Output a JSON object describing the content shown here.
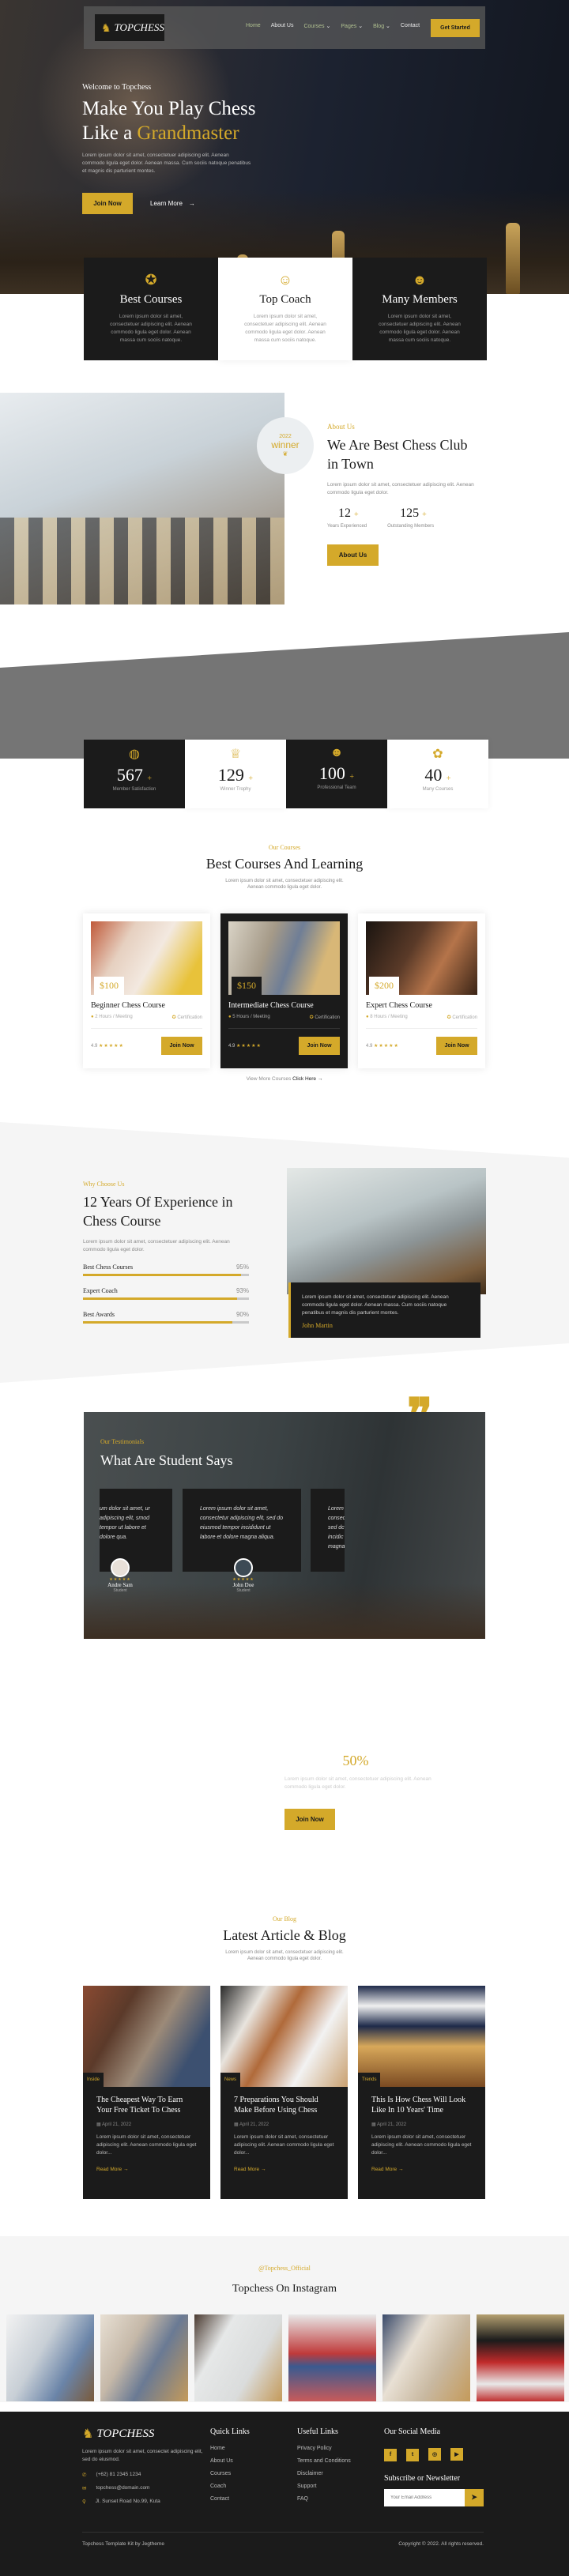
{
  "brand": {
    "name": "TOPCHESS",
    "accent": "#d4a92a",
    "dark": "#1b1b1b"
  },
  "nav": {
    "items": [
      {
        "label": "Home",
        "active": true
      },
      {
        "label": "About Us"
      },
      {
        "label": "Courses",
        "dropdown": true
      },
      {
        "label": "Pages",
        "dropdown": true
      },
      {
        "label": "Blog",
        "dropdown": true
      },
      {
        "label": "Contact"
      }
    ],
    "cta": "Get Started"
  },
  "hero": {
    "kicker": "Welcome to Topchess",
    "title_line1": "Make You Play Chess",
    "title_line2_prefix": "Like a ",
    "title_highlight": "Grandmaster",
    "text": "Lorem ipsum dolor sit amet, consectetuer adipiscing elit. Aenean commodo ligula eget dolor. Aenean massa. Cum sociis natoque penatibus et magnis dis parturient montes.",
    "primary_btn": "Join Now",
    "secondary_btn": "Learn More",
    "secondary_icon": "→"
  },
  "features": [
    {
      "icon": "award-ribbon-icon",
      "title": "Best Courses",
      "text": "Lorem ipsum dolor sit amet, consectetuer adipiscing elit. Aenean commodo ligula eget dolor. Aenean massa cum sociis natoque."
    },
    {
      "icon": "user-check-icon",
      "title": "Top Coach",
      "text": "Lorem ipsum dolor sit amet, consectetuer adipiscing elit. Aenean commodo ligula eget dolor. Aenean massa cum sociis natoque."
    },
    {
      "icon": "users-icon",
      "title": "Many Members",
      "text": "Lorem ipsum dolor sit amet, consectetuer adipiscing elit. Aenean commodo ligula eget dolor. Aenean massa cum sociis natoque."
    }
  ],
  "about": {
    "badge_year": "2022",
    "badge_text": "winner",
    "kicker": "About Us",
    "title_line1": "We Are Best Chess Club",
    "title_line2": "in Town",
    "text": "Lorem ipsum dolor sit amet, consectetuer adipiscing elit. Aenean commodo ligula eget dolor.",
    "counters": [
      {
        "value": "12",
        "suffix": "+",
        "label": "Years Experienced"
      },
      {
        "value": "125",
        "suffix": "+",
        "label": "Outstanding Members"
      }
    ],
    "button": "About Us"
  },
  "stats": [
    {
      "icon": "globe-members-icon",
      "value": "567",
      "suffix": "+",
      "label": "Member Satisfaction"
    },
    {
      "icon": "trophy-icon",
      "value": "129",
      "suffix": "+",
      "label": "Winner Trophy"
    },
    {
      "icon": "team-icon",
      "value": "100",
      "suffix": "+",
      "label": "Professional Team"
    },
    {
      "icon": "thumbs-up-badge-icon",
      "value": "40",
      "suffix": "+",
      "label": "Many Courses"
    }
  ],
  "courses_section": {
    "kicker": "Our Courses",
    "title": "Best Courses And Learning",
    "text_line1": "Lorem ipsum dolor sit amet, consectetuer adipiscing elit.",
    "text_line2": "Aenean commodo ligula eget dolor.",
    "more_text": "View More Courses",
    "more_link": "Click Here",
    "more_icon": "→"
  },
  "courses": [
    {
      "price": "$100",
      "title": "Beginner Chess Course",
      "duration": "2 Hours / Meeting",
      "cert": "Certification",
      "rating": "4.9",
      "stars": 5,
      "button": "Join Now"
    },
    {
      "price": "$150",
      "title": "Intermediate Chess Course",
      "duration": "5 Hours / Meeting",
      "cert": "Certification",
      "rating": "4.9",
      "stars": 5,
      "button": "Join Now"
    },
    {
      "price": "$200",
      "title": "Expert Chess Course",
      "duration": "8 Hours / Meeting",
      "cert": "Certification",
      "rating": "4.9",
      "stars": 5,
      "button": "Join Now"
    }
  ],
  "why": {
    "kicker": "Why Choose Us",
    "title_line1": "12 Years Of Experience in",
    "title_line2": "Chess Course",
    "text": "Lorem ipsum dolor sit amet, consectetuer adipiscing elit. Aenean commodo ligula eget dolor.",
    "bars": [
      {
        "label": "Best Chess Courses",
        "value": "95%",
        "pct": 95
      },
      {
        "label": "Expert Coach",
        "value": "93%",
        "pct": 93
      },
      {
        "label": "Best Awards",
        "value": "90%",
        "pct": 90
      }
    ],
    "quote": "Lorem ipsum dolor sit amet, consectetuer adipiscing elit. Aenean commodo ligula eget dolor. Aenean massa. Cum sociis natoque penatibus et magnis dis parturient montes.",
    "quote_author": "John Martin"
  },
  "testimonials": {
    "kicker": "Our Testimonials",
    "title": "What Are Student Says",
    "items": [
      {
        "text": "um dolor sit amet, ur adipiscing elit, smod tempor ut labore et dolore qua.",
        "name": "Andre Sam",
        "role": "Student",
        "stars": 4.5
      },
      {
        "text": "Lorem ipsum dolor sit amet, consectetur adipiscing elit, sed do eiusmod tempor incididunt ut labore et dolore magna aliqua.",
        "name": "John Doe",
        "role": "Student",
        "stars": 4.5
      },
      {
        "text": "Lorem consec sed dc incidic magna",
        "name": "",
        "role": "",
        "stars": 0
      }
    ]
  },
  "promo": {
    "value": "50%",
    "text": "Lorem ipsum dolor sit amet, consectetuer adipiscing elit. Aenean commodo ligula eget dolor.",
    "button": "Join Now"
  },
  "blog_section": {
    "kicker": "Our Blog",
    "title": "Latest Article & Blog",
    "text_line1": "Lorem ipsum dolor sit amet, consectetuer adipiscing elit.",
    "text_line2": "Aenean commodo ligula eget dolor."
  },
  "blog": [
    {
      "tag": "Inside",
      "title": "The Cheapest Way To Earn Your Free Ticket To Chess",
      "date": "April 21, 2022",
      "excerpt": "Lorem ipsum dolor sit amet, consectetuer adipiscing elit. Aenean commodo ligula eget dolor...",
      "read_more": "Read More"
    },
    {
      "tag": "News",
      "title": "7 Preparations You Should Make Before Using Chess",
      "date": "April 21, 2022",
      "excerpt": "Lorem ipsum dolor sit amet, consectetuer adipiscing elit. Aenean commodo ligula eget dolor...",
      "read_more": "Read More"
    },
    {
      "tag": "Trends",
      "title": "This Is How Chess Will Look Like In 10 Years' Time",
      "date": "April 21, 2022",
      "excerpt": "Lorem ipsum dolor sit amet, consectetuer adipiscing elit. Aenean commodo ligula eget dolor...",
      "read_more": "Read More"
    }
  ],
  "instagram": {
    "kicker": "@Topchess_Official",
    "title": "Topchess On Instagram",
    "photos": [
      "father-son-chess",
      "men-playing-chess",
      "man-thinking-chess",
      "kids-giant-chess",
      "coaching-session",
      "graduate-kid-chess"
    ]
  },
  "footer": {
    "about": "Lorem ipsum dolor sit amet, consectet adipiscing elit, sed do eiusmod.",
    "phone": "(+62) 81 2345 1234",
    "email": "topchess@domain.com",
    "address": "Jl. Sunset Road No.99, Kuta",
    "quick_title": "Quick Links",
    "quick_links": [
      "Home",
      "About Us",
      "Courses",
      "Coach",
      "Contact"
    ],
    "useful_title": "Useful Links",
    "useful_links": [
      "Privacy Policy",
      "Terms and Conditions",
      "Disclaimer",
      "Support",
      "FAQ"
    ],
    "social_title": "Our Social Media",
    "social": [
      {
        "icon": "facebook-icon",
        "glyph": "f"
      },
      {
        "icon": "twitter-icon",
        "glyph": "t"
      },
      {
        "icon": "instagram-icon",
        "glyph": "◎"
      },
      {
        "icon": "youtube-icon",
        "glyph": "▶"
      }
    ],
    "newsletter_title": "Subscribe or Newsletter",
    "email_placeholder": "Your Email Address",
    "credit": "Topchess Template Kit by Jegtheme",
    "copyright": "Copyright © 2022. All rights reserved."
  }
}
